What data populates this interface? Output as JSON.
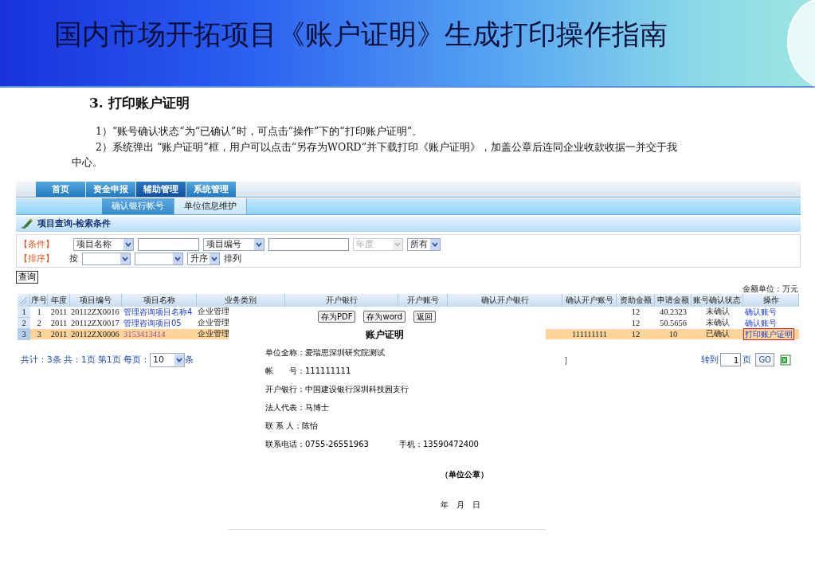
{
  "slide": {
    "title": "国内市场开拓项目《账户证明》生成打印操作指南",
    "section_heading": "3. 打印账户证明",
    "paragraphs": [
      "1）“账号确认状态“为“已确认”时，可点击“操作”下的“打印账户证明”。",
      "2）系统弹出 “账户证明”框，用户可以点击“另存为WORD”并下载打印《账户证明》，加盖公章后连同企业收款收据一并交于我中心。"
    ]
  },
  "screen": {
    "nav_tabs": [
      {
        "label": "首页",
        "selected": false
      },
      {
        "label": "资金申报",
        "selected": false
      },
      {
        "label": "辅助管理",
        "selected": true
      },
      {
        "label": "系统管理",
        "selected": false
      }
    ],
    "sub_tabs": [
      {
        "label": "确认银行帐号",
        "selected": true
      },
      {
        "label": "单位信息维护",
        "selected": false
      }
    ],
    "panel_title": "项目查询-检索条件",
    "condition_label": "【条件】",
    "condition_controls": [
      {
        "kind": "select",
        "value": "项目名称",
        "disabled": false
      },
      {
        "kind": "input",
        "disabled": false
      },
      {
        "kind": "select",
        "value": "项目编号",
        "disabled": false
      },
      {
        "kind": "input",
        "disabled": false
      },
      {
        "kind": "select",
        "value": "年度",
        "disabled": true
      },
      {
        "kind": "select",
        "value": "所有",
        "disabled": false
      }
    ],
    "sort_label": "【排序】",
    "sort_controls": [
      {
        "kind": "text",
        "value": "按"
      },
      {
        "kind": "select",
        "disabled": false
      },
      {
        "kind": "select",
        "disabled": false
      },
      {
        "kind": "select",
        "value": "升序",
        "disabled": false
      },
      {
        "kind": "text",
        "value": "排列"
      }
    ],
    "search_button": "查询",
    "amount_unit": "金额单位：万元",
    "table": {
      "columns": [
        "序号",
        "年度",
        "项目编号",
        "项目名称",
        "业务类别",
        "开户银行",
        "开户账号",
        "确认开户银行",
        "确认开户账号",
        "资助金额",
        "申请金额",
        "账号确认状态",
        "操作"
      ],
      "rows": [
        {
          "row_number": "1",
          "selected": false,
          "seq": "1",
          "year": "2011",
          "code": "20112ZX0016",
          "name": "管理咨询项目名称4",
          "category": "企业管理",
          "funding": "12",
          "requested": "40.2323",
          "status": "未确认",
          "action": "确认账号",
          "action_highlighted": false
        },
        {
          "row_number": "2",
          "selected": false,
          "seq": "2",
          "year": "2011",
          "code": "20112ZX0017",
          "name": "管理咨询项目05",
          "category": "企业管理",
          "funding": "12",
          "requested": "50.5656",
          "status": "未确认",
          "action": "确认账号",
          "action_highlighted": false
        },
        {
          "row_number": "3",
          "selected": true,
          "seq": "3",
          "year": "2011",
          "code": "20112ZX0006",
          "name": "3153413414",
          "category": "企业管理",
          "confirm_account": "111111111",
          "funding": "12",
          "requested": "10",
          "status": "已确认",
          "action": "打印账户证明",
          "action_highlighted": true
        }
      ]
    },
    "pager": {
      "summary": "共计：3条 共：1页 第1页 每页：",
      "page_size": "10",
      "page_size_unit": "条",
      "fragment": "]",
      "goto_label": "转到",
      "goto_value": "1",
      "goto_unit": "页",
      "go_button": "GO"
    }
  },
  "dialog": {
    "buttons": [
      "存为PDF",
      "存为word",
      "返回"
    ],
    "title": "账户证明",
    "fields": [
      [
        "单位全称：爱瑞思深圳研究院测试"
      ],
      [
        "帐　　号：111111111"
      ],
      [
        "开户银行：中国建设银行深圳科技园支行"
      ],
      [
        "法人代表：马博士"
      ],
      [
        "联 系 人：陈怡"
      ],
      [
        "联系电话：0755-26551963",
        "手机：13590472400"
      ]
    ],
    "seal": "（单位公章）",
    "date": "年　月　日"
  }
}
